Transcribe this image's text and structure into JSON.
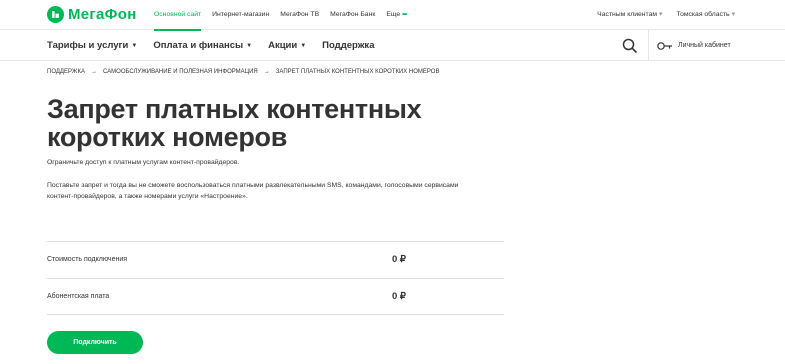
{
  "brand": {
    "name": "МегаФон",
    "color": "#00b956"
  },
  "top_nav": {
    "items": [
      "Основной сайт",
      "Интернет-магазин",
      "МегаФон ТВ",
      "МегаФон Банк",
      "Еще"
    ],
    "active_index": 0,
    "clients_label": "Частным клиентам",
    "region_label": "Томская область"
  },
  "main_nav": {
    "items": [
      "Тарифы и услуги",
      "Оплата и финансы",
      "Акции",
      "Поддержка"
    ],
    "cabinet_label": "Личный кабинет",
    "icons": [
      "search-icon",
      "key-icon"
    ]
  },
  "breadcrumb": [
    "ПОДДЕРЖКА",
    "САМООБСЛУЖИВАНИЕ И ПОЛЕЗНАЯ ИНФОРМАЦИЯ",
    "ЗАПРЕТ ПЛАТНЫХ КОНТЕНТНЫХ КОРОТКИХ НОМЕРОВ"
  ],
  "page": {
    "title_line1": "Запрет платных контентных",
    "title_line2": "коротких номеров",
    "lead": "Ограничьте доступ к платным услугам контент-провайдеров.",
    "description_line1": "Поставьте запрет и тогда вы не сможете воспользоваться платными развлекательными SMS, командами, голосовыми сервисами",
    "description_line2": "контент-провайдеров, а также номерами услуги «Настроение»."
  },
  "prices": [
    {
      "label": "Стоимость подключения",
      "value": "0 ₽"
    },
    {
      "label": "Абонентская плата",
      "value": "0 ₽"
    }
  ],
  "connect_button": "Подключить"
}
